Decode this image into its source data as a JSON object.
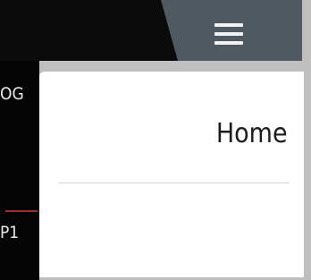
{
  "header": {
    "menu_icon": "hamburger-menu-icon"
  },
  "sidebar": {
    "items": [
      {
        "label": "OG"
      },
      {
        "label": "P1"
      }
    ]
  },
  "main": {
    "title": "Home"
  },
  "colors": {
    "topbar": "#0b0b0b",
    "topbar_accent": "#4f5961",
    "rail": "#050505",
    "panel": "#ffffff",
    "rail_divider": "#9b2d2d"
  }
}
